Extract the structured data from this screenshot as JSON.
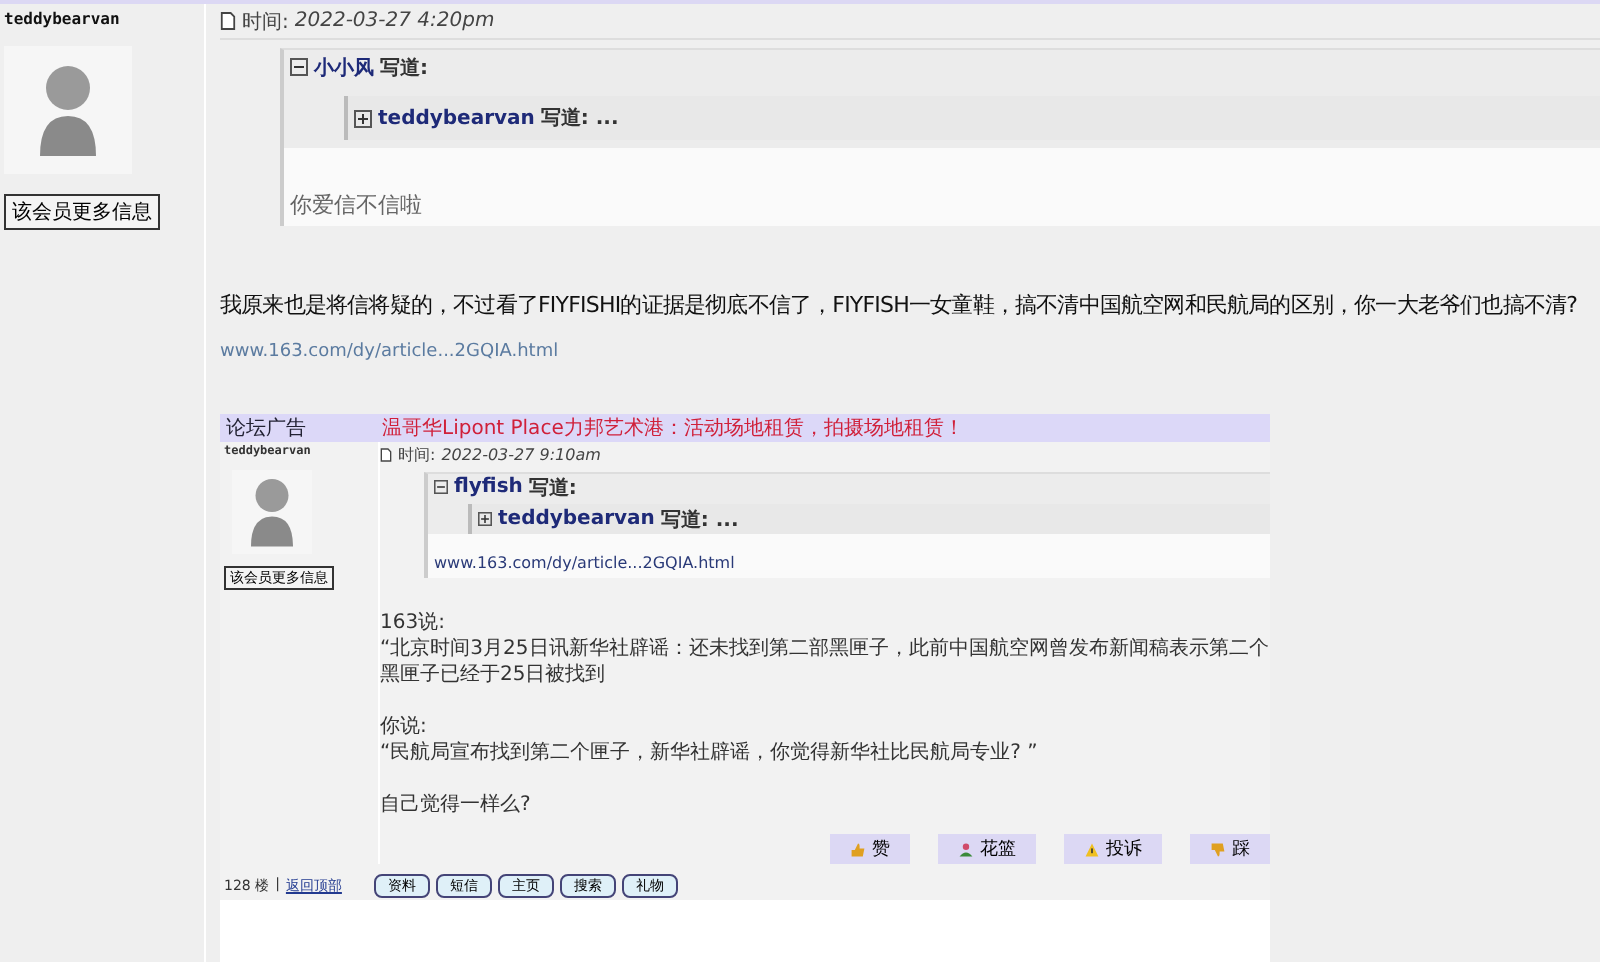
{
  "author": {
    "name": "teddybearvan",
    "profile_button": "该会员更多信息"
  },
  "post": {
    "time_label": "时间:",
    "time": "2022-03-27 4:20pm",
    "quote": {
      "author": "小小风",
      "says": "写道:",
      "expanded": true,
      "nested": {
        "author": "teddybearvan",
        "says": "写道: ...",
        "expanded": false
      },
      "body": "你爱信不信啦"
    },
    "body": "我原来也是将信将疑的，不过看了FIYFISHI的证据是彻底不信了，FIYFISH一女童鞋，搞不清中国航空网和民航局的区别，你一大老爷们也搞不清?",
    "link": "www.163.com/dy/article...2GQIA.html"
  },
  "embedded_screenshot": {
    "ad_label": "论坛广告",
    "ad_text": "温哥华Lipont Place力邦艺术港：活动场地租赁，拍摄场地租赁！",
    "author": {
      "name": "teddybearvan",
      "profile_button": "该会员更多信息"
    },
    "time_label": "时间:",
    "time": "2022-03-27 9:10am",
    "quote": {
      "author": "flyfish",
      "says": "写道:",
      "expanded": true,
      "nested": {
        "author": "teddybearvan",
        "says": "写道: ...",
        "expanded": false
      },
      "body": "www.163.com/dy/article...2GQIA.html"
    },
    "paragraphs": [
      "163说:",
      "“北京时间3月25日讯新华社辟谣：还未找到第二部黑匣子，此前中国航空网曾发布新闻稿表示第二个黑匣子已经于25日被找到",
      "你说:",
      "“民航局宣布找到第二个匣子，新华社辟谣，你觉得新华社比民航局专业? ”",
      "自己觉得一样么?"
    ],
    "vote_buttons": [
      "赞",
      "花篮",
      "投诉",
      "踩"
    ],
    "floor": "128 楼",
    "separator": "|",
    "back_to_top": "返回顶部",
    "action_buttons": [
      "资料",
      "短信",
      "主页",
      "搜索",
      "礼物"
    ]
  }
}
